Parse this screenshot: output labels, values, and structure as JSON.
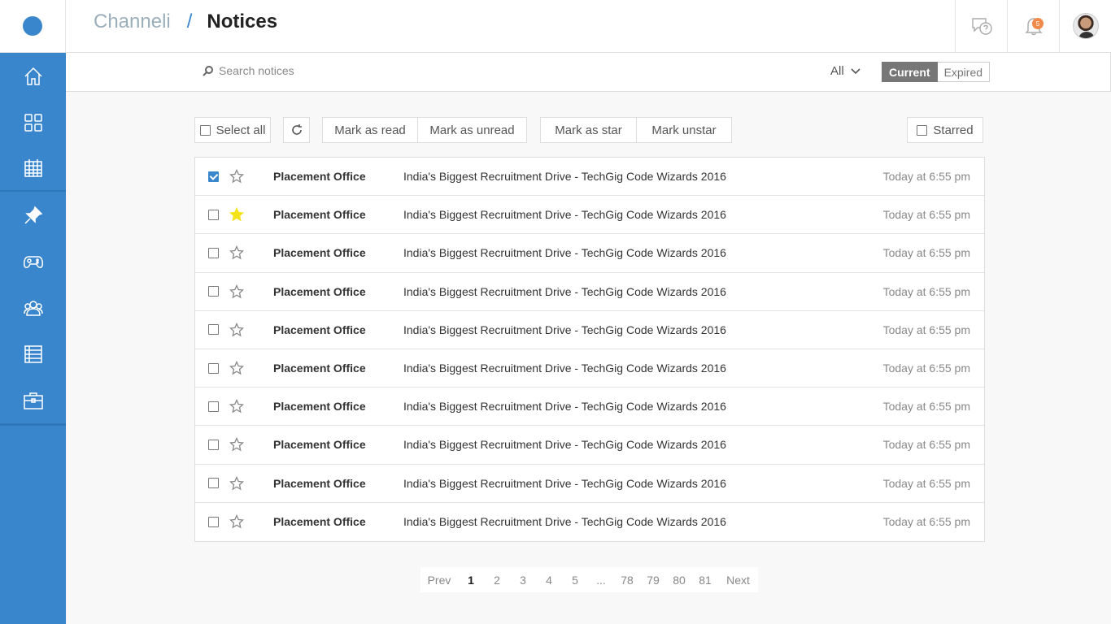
{
  "app": {
    "title": "Channeli",
    "separator": "/",
    "page": "Notices"
  },
  "header": {
    "notification_count": "5"
  },
  "search": {
    "placeholder": "Search notices"
  },
  "filter": {
    "selected": "All",
    "tabs": [
      "Current",
      "Expired"
    ],
    "active_tab": "Current"
  },
  "toolbar": {
    "select_all": "Select all",
    "mark_read": "Mark as read",
    "mark_unread": "Mark as unread",
    "mark_star": "Mark as star",
    "mark_unstar": "Mark unstar",
    "starred": "Starred"
  },
  "notices": [
    {
      "sender": "Placement Office",
      "subject": "India's Biggest Recruitment Drive - TechGig Code Wizards 2016",
      "time": "Today at 6:55 pm",
      "checked": true,
      "starred": false
    },
    {
      "sender": "Placement Office",
      "subject": "India's Biggest Recruitment Drive - TechGig Code Wizards 2016",
      "time": "Today at 6:55 pm",
      "checked": false,
      "starred": true
    },
    {
      "sender": "Placement Office",
      "subject": "India's Biggest Recruitment Drive - TechGig Code Wizards 2016",
      "time": "Today at 6:55 pm",
      "checked": false,
      "starred": false
    },
    {
      "sender": "Placement Office",
      "subject": "India's Biggest Recruitment Drive - TechGig Code Wizards 2016",
      "time": "Today at 6:55 pm",
      "checked": false,
      "starred": false
    },
    {
      "sender": "Placement Office",
      "subject": "India's Biggest Recruitment Drive - TechGig Code Wizards 2016",
      "time": "Today at 6:55 pm",
      "checked": false,
      "starred": false
    },
    {
      "sender": "Placement Office",
      "subject": "India's Biggest Recruitment Drive - TechGig Code Wizards 2016",
      "time": "Today at 6:55 pm",
      "checked": false,
      "starred": false
    },
    {
      "sender": "Placement Office",
      "subject": "India's Biggest Recruitment Drive - TechGig Code Wizards 2016",
      "time": "Today at 6:55 pm",
      "checked": false,
      "starred": false
    },
    {
      "sender": "Placement Office",
      "subject": "India's Biggest Recruitment Drive - TechGig Code Wizards 2016",
      "time": "Today at 6:55 pm",
      "checked": false,
      "starred": false
    },
    {
      "sender": "Placement Office",
      "subject": "India's Biggest Recruitment Drive - TechGig Code Wizards 2016",
      "time": "Today at 6:55 pm",
      "checked": false,
      "starred": false
    },
    {
      "sender": "Placement Office",
      "subject": "India's Biggest Recruitment Drive - TechGig Code Wizards 2016",
      "time": "Today at 6:55 pm",
      "checked": false,
      "starred": false
    }
  ],
  "pagination": {
    "prev": "Prev",
    "next": "Next",
    "pages": [
      "1",
      "2",
      "3",
      "4",
      "5",
      "...",
      "78",
      "79",
      "80",
      "81"
    ],
    "current": "1"
  },
  "sidebar": {
    "icons": [
      "home-icon",
      "apps-icon",
      "calendar-icon",
      "pin-icon",
      "gamepad-icon",
      "groups-icon",
      "list-icon",
      "briefcase-icon"
    ]
  },
  "colors": {
    "primary": "#3a86cd",
    "star": "#f5e31a",
    "badge": "#f08a4b"
  }
}
